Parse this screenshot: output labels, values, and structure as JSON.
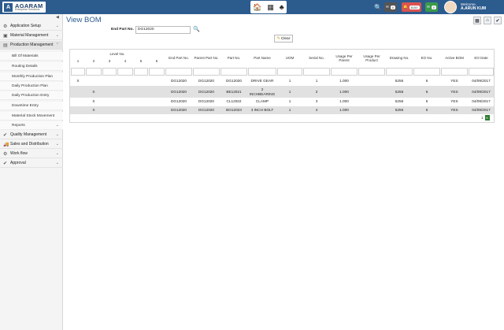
{
  "brand": {
    "name": "AGARAM",
    "tagline": "Enterprise Solutions",
    "mark": "A"
  },
  "topbar": {
    "apps": [
      "🏠",
      "▦",
      "♣"
    ],
    "search_icon": "🔍",
    "badges": [
      {
        "icon": "✉",
        "count": "0",
        "color": "#555555"
      },
      {
        "icon": "🔔",
        "count": "8100",
        "color": "#d9534f"
      },
      {
        "icon": "✉",
        "count": "0",
        "color": "#3a9a4a"
      }
    ],
    "welcome_label": "Welcome,",
    "user_name": "A.ARUN KUM"
  },
  "sidebar": {
    "collapse": "◀",
    "items": [
      {
        "icon": "⚙",
        "label": "Application Setup",
        "chevron": "⌄"
      },
      {
        "icon": "▣",
        "label": "Material Management",
        "chevron": "⌄"
      },
      {
        "icon": "▤",
        "label": "Production Management",
        "chevron": "⌃"
      }
    ],
    "sub_items": [
      {
        "label": "Bill Of Materials"
      },
      {
        "label": "Routing Details"
      },
      {
        "label": "Monthly Production Plan"
      },
      {
        "label": "Daily Production Plan"
      },
      {
        "label": "Daily Production Entry"
      },
      {
        "label": "Downtime Entry"
      },
      {
        "label": "Material Stock Movement"
      },
      {
        "label": "Reports",
        "chevron": "⌄"
      }
    ],
    "items_after": [
      {
        "icon": "✔",
        "label": "Quality Management",
        "chevron": "⌄"
      },
      {
        "icon": "🚚",
        "label": "Sales and Distribution",
        "chevron": "⌄"
      },
      {
        "icon": "⚙",
        "label": "Work flow",
        "chevron": "⌄"
      },
      {
        "icon": "✔",
        "label": "Approval",
        "chevron": "⌄"
      }
    ]
  },
  "page": {
    "title": "View BOM",
    "filter_label": "End Part No.",
    "filter_value": "DG12020",
    "clear_label": "Clear",
    "toolbar_icons": [
      "▦",
      "⌂",
      "✔"
    ]
  },
  "grid": {
    "level_header": "Level No.",
    "levels": [
      "1",
      "2",
      "3",
      "4",
      "5",
      "6"
    ],
    "columns": [
      "End Part No.",
      "Parent Part No.",
      "Part No.",
      "Part Name",
      "UOM",
      "Serial No.",
      "Usage Per Parent",
      "Usage Per Product",
      "Drawing No.",
      "EO No.",
      "Active BOM",
      "EO Date"
    ],
    "rows": [
      {
        "level": 1,
        "mark": "X",
        "cells": [
          "DG12020",
          "DG12020",
          "DG12020",
          "DRIVE GEAR",
          "1",
          "1",
          "1.000",
          "",
          "5256",
          "6",
          "YES",
          "04/09/2017"
        ]
      },
      {
        "level": 2,
        "mark": "X",
        "cells": [
          "DG12020",
          "DG12020",
          "BE12021",
          "2 INCHBEARING",
          "1",
          "2",
          "1.000",
          "",
          "5256",
          "6",
          "YES",
          "04/09/2017"
        ]
      },
      {
        "level": 2,
        "mark": "X",
        "cells": [
          "DG12020",
          "DG12020",
          "CL12022",
          "CLAMP",
          "1",
          "3",
          "1.000",
          "",
          "5256",
          "6",
          "YES",
          "04/09/2017"
        ]
      },
      {
        "level": 2,
        "mark": "X",
        "cells": [
          "DG12020",
          "DG12020",
          "BO12023",
          "3 INCH BOLT",
          "1",
          "4",
          "1.000",
          "",
          "5256",
          "6",
          "YES",
          "04/09/2017"
        ]
      }
    ],
    "page_number": "1",
    "export_icon": "X"
  }
}
